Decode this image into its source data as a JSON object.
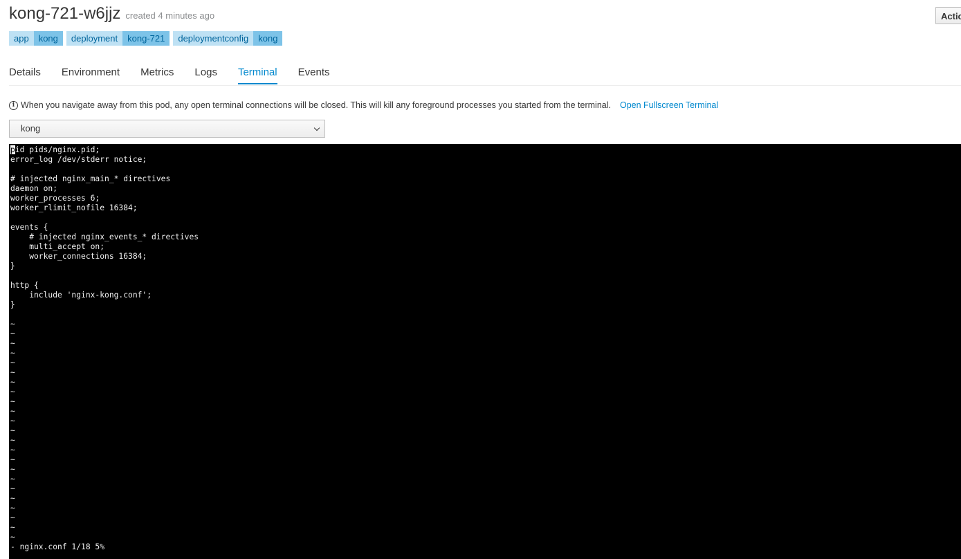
{
  "pod": {
    "name": "kong-721-w6jjz",
    "created": "created 4 minutes ago"
  },
  "actions_label": "Actio",
  "labels": [
    {
      "key": "app",
      "value": "kong"
    },
    {
      "key": "deployment",
      "value": "kong-721"
    },
    {
      "key": "deploymentconfig",
      "value": "kong"
    }
  ],
  "tabs": [
    {
      "label": "Details",
      "active": false
    },
    {
      "label": "Environment",
      "active": false
    },
    {
      "label": "Metrics",
      "active": false
    },
    {
      "label": "Logs",
      "active": false
    },
    {
      "label": "Terminal",
      "active": true
    },
    {
      "label": "Events",
      "active": false
    }
  ],
  "info": {
    "message": "When you navigate away from this pod, any open terminal connections will be closed. This will kill any foreground processes you started from the terminal.",
    "link": "Open Fullscreen Terminal"
  },
  "container_select": {
    "value": "kong"
  },
  "terminal": {
    "cursor_char": "p",
    "first_line_rest": "id pids/nginx.pid;",
    "lines": [
      "error_log /dev/stderr notice;",
      "",
      "# injected nginx_main_* directives",
      "daemon on;",
      "worker_processes 6;",
      "worker_rlimit_nofile 16384;",
      "",
      "events {",
      "    # injected nginx_events_* directives",
      "    multi_accept on;",
      "    worker_connections 16384;",
      "}",
      "",
      "http {",
      "    include 'nginx-kong.conf';",
      "}",
      "",
      "~",
      "~",
      "~",
      "~",
      "~",
      "~",
      "~",
      "~",
      "~",
      "~",
      "~",
      "~",
      "~",
      "~",
      "~",
      "~",
      "~",
      "~",
      "~",
      "~",
      "~",
      "~",
      "~"
    ],
    "status_line": "- nginx.conf 1/18 5%"
  }
}
